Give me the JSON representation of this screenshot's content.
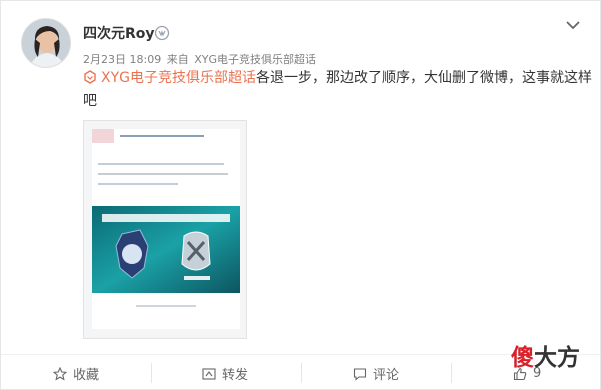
{
  "post": {
    "username": "四次元Roy",
    "verify_icon": "vip-badge-icon",
    "time": "2月23日 18:09",
    "from_label": "来自",
    "source": "XYG电子竞技俱乐部超话",
    "topic_icon": "super-topic-icon",
    "topic": "XYG电子竞技俱乐部超话",
    "text": "各退一步，那边改了顺序，大仙删了微博，这事就这样吧"
  },
  "actions": {
    "favorite_label": "收藏",
    "repost_label": "转发",
    "comment_label": "评论",
    "like_count": "9"
  },
  "watermark": {
    "part1": "傻",
    "part2": "大方"
  },
  "colors": {
    "accent": "#eb7350",
    "text": "#333333",
    "muted": "#808080"
  }
}
